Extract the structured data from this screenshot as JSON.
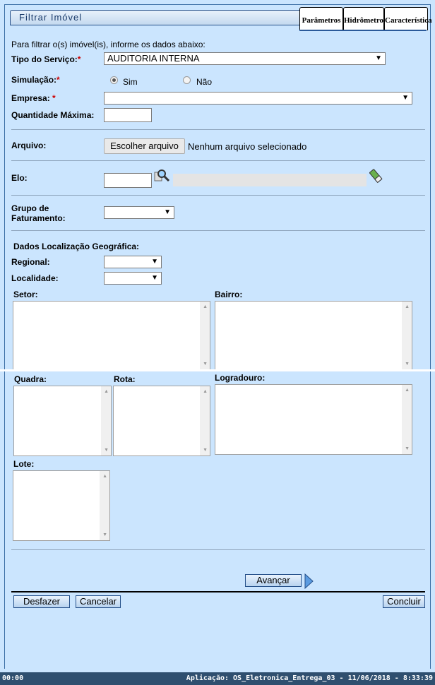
{
  "header": {
    "title": "Filtrar Imóvel"
  },
  "tabs": [
    {
      "label": "Parâmetros"
    },
    {
      "label": "Hidrômetro"
    },
    {
      "label": "Característica"
    }
  ],
  "form": {
    "intro": "Para filtrar o(s) imóvel(is), informe os dados abaixo:",
    "tipo_servico_label": "Tipo do Serviço:",
    "tipo_servico_value": "AUDITORIA INTERNA",
    "simulacao_label": "Simulação:",
    "simulacao_sim": "Sim",
    "simulacao_nao": "Não",
    "empresa_label": "Empresa:",
    "quantidade_label": "Quantidade Máxima:",
    "required_mark": "*",
    "arquivo_label": "Arquivo:",
    "arquivo_button": "Escolher arquivo",
    "arquivo_status": "Nenhum arquivo selecionado",
    "elo_label": "Elo:",
    "grupo_label_1": "Grupo de",
    "grupo_label_2": "Faturamento:",
    "geo_title": "Dados Localização Geográfica:",
    "regional_label": "Regional:",
    "localidade_label": "Localidade:",
    "setor_label": "Setor:",
    "bairro_label": "Bairro:",
    "quadra_label": "Quadra:",
    "rota_label": "Rota:",
    "logradouro_label": "Logradouro:",
    "lote_label": "Lote:"
  },
  "buttons": {
    "avancar": "Avançar",
    "desfazer": "Desfazer",
    "cancelar": "Cancelar",
    "concluir": "Concluir"
  },
  "status_bar": {
    "left": "00:00",
    "right": "Aplicação: OS_Eletronica_Entrega_03 - 11/06/2018 - 8:33:39"
  },
  "icons": {
    "dropdown": "▼",
    "scroll_up": "▲",
    "scroll_down": "▼",
    "next": "▶"
  },
  "colors": {
    "background": "#cbe5fe",
    "border_blue": "#25508a",
    "required": "#cc0000",
    "status_bar": "#2f4f6f"
  }
}
